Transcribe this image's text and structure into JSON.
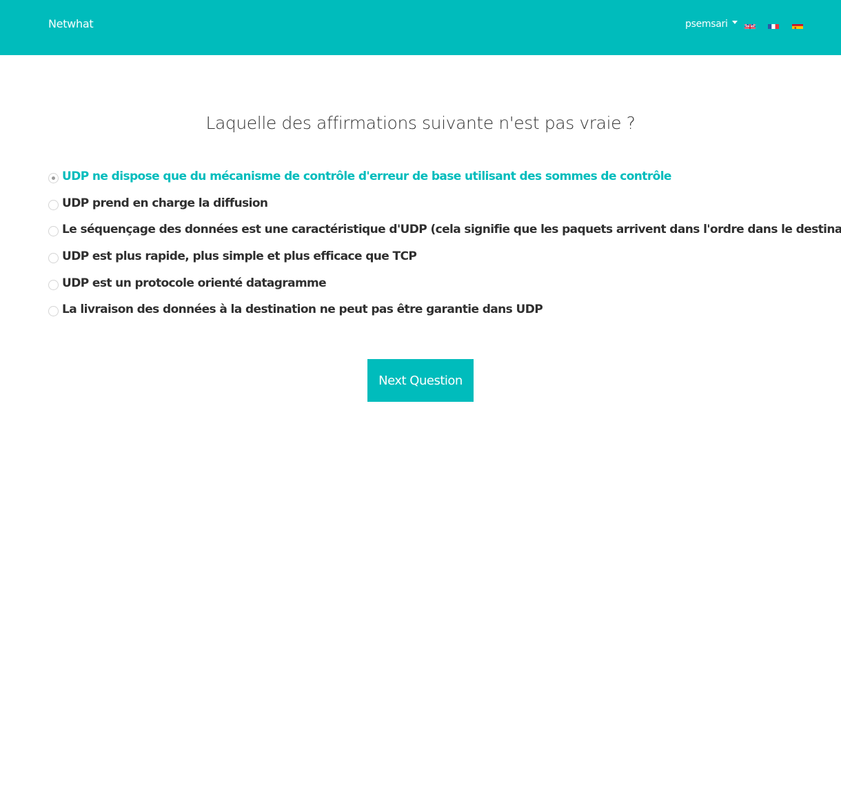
{
  "navbar": {
    "brand": "Netwhat",
    "username": "psemsari",
    "languages": [
      {
        "code": "en",
        "icon": "uk-flag-icon"
      },
      {
        "code": "fr",
        "icon": "france-flag-icon"
      },
      {
        "code": "es",
        "icon": "spain-flag-icon"
      }
    ],
    "accent_color": "#00bcbc"
  },
  "quiz": {
    "question": "Laquelle des affirmations suivante n'est pas vraie ?",
    "selected_index": 0,
    "options": [
      "UDP ne dispose que du mécanisme de contrôle d'erreur de base utilisant des sommes de contrôle",
      "UDP prend en charge la diffusion",
      "Le séquençage des données est une caractéristique d'UDP (cela signifie que les paquets arrivent dans l'ordre dans le destinataire)",
      "UDP est plus rapide, plus simple et plus efficace que TCP",
      "UDP est un protocole orienté datagramme",
      "La livraison des données à la destination ne peut pas être garantie dans UDP"
    ],
    "next_label": "Next Question"
  }
}
